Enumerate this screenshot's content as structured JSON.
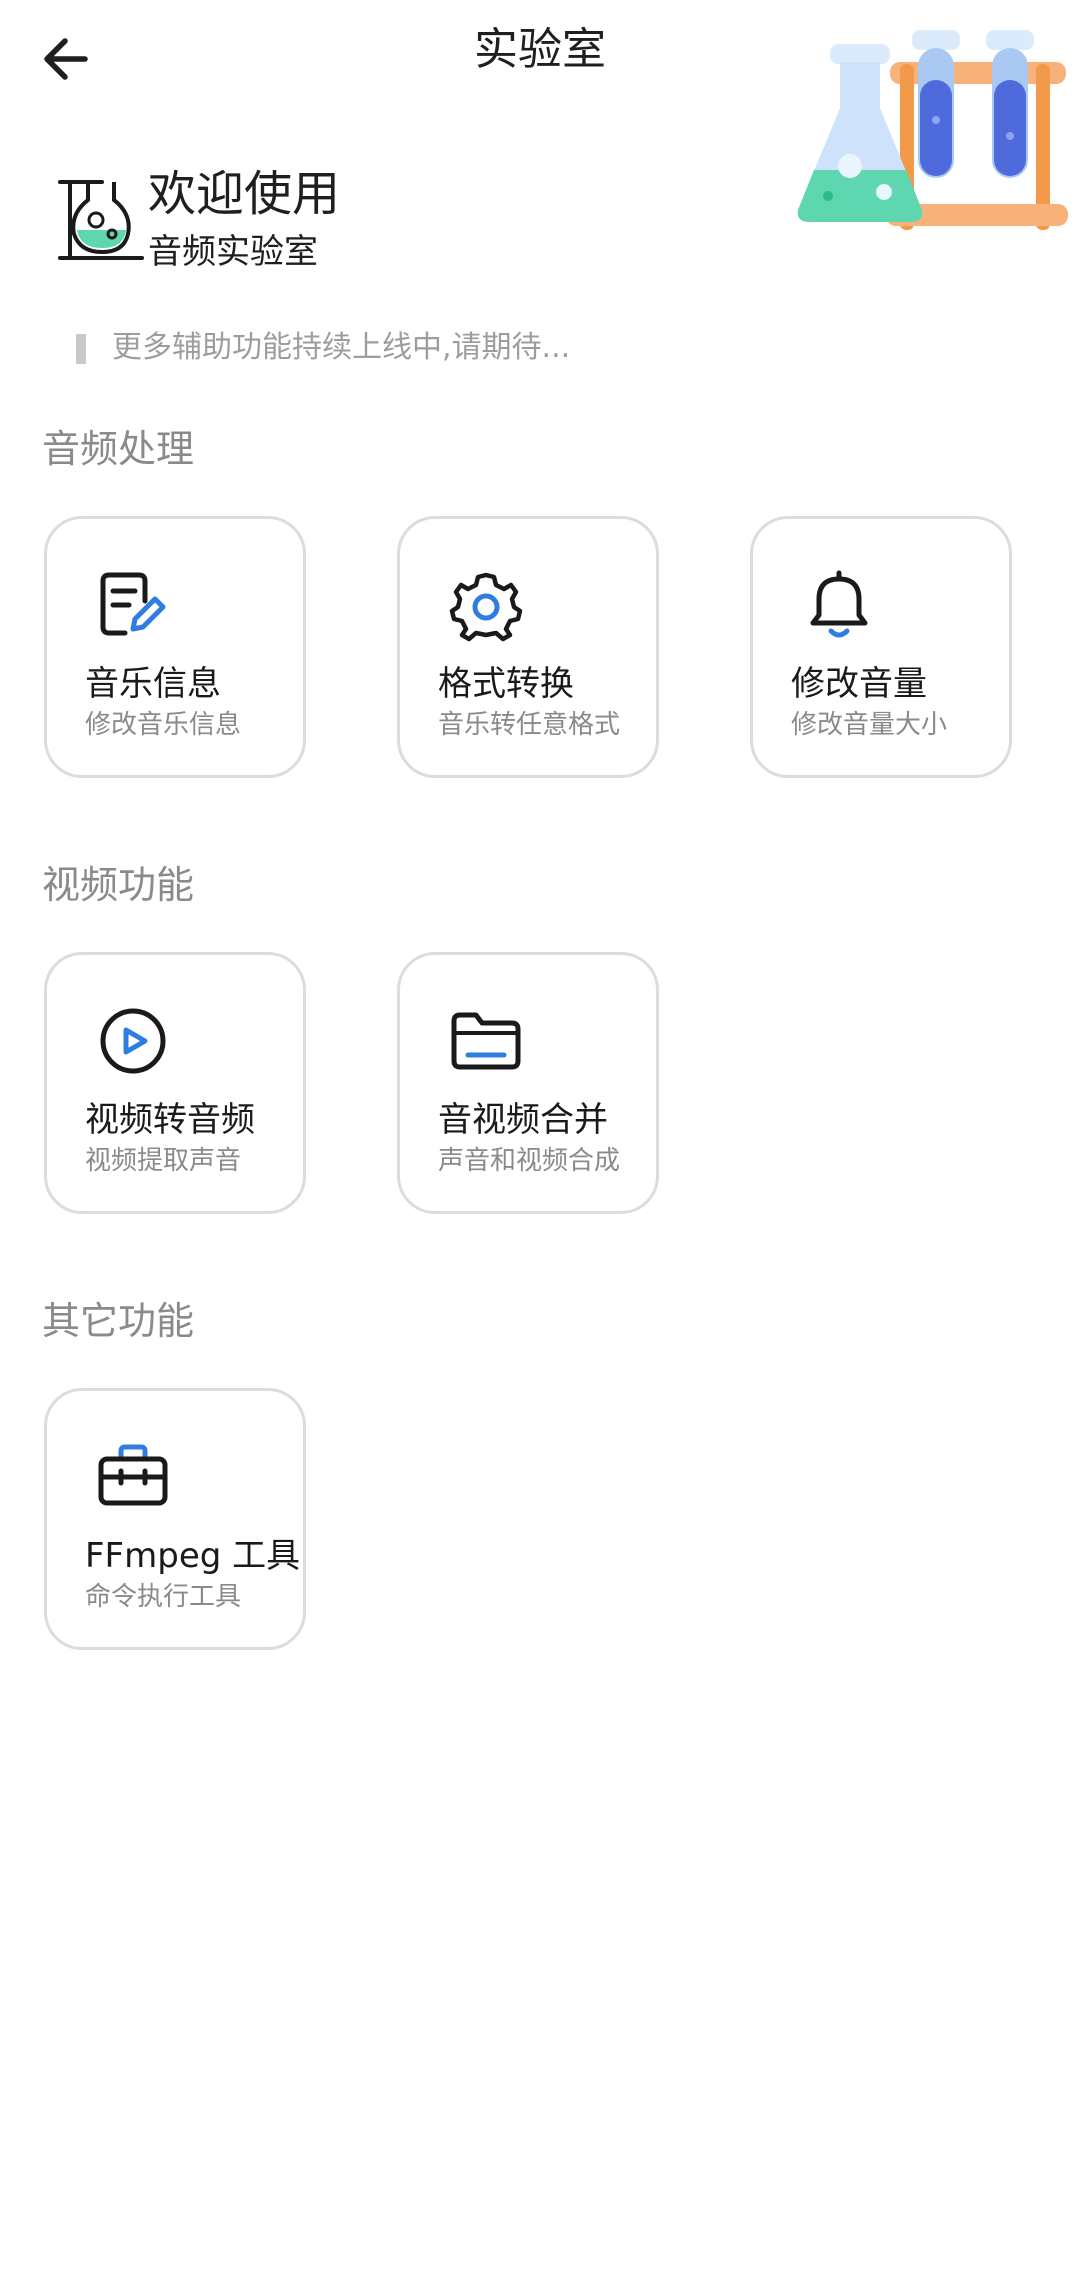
{
  "header": {
    "title": "实验室",
    "back_icon": "arrow-left-icon"
  },
  "welcome": {
    "title": "欢迎使用",
    "subtitle": "音频实验室"
  },
  "notice": "更多辅助功能持续上线中,请期待...",
  "sections": [
    {
      "title": "音频处理",
      "cards": [
        {
          "title": "音乐信息",
          "subtitle": "修改音乐信息",
          "icon": "edit-document-icon"
        },
        {
          "title": "格式转换",
          "subtitle": "音乐转任意格式",
          "icon": "gear-icon"
        },
        {
          "title": "修改音量",
          "subtitle": "修改音量大小",
          "icon": "bell-icon"
        }
      ]
    },
    {
      "title": "视频功能",
      "cards": [
        {
          "title": "视频转音频",
          "subtitle": "视频提取声音",
          "icon": "play-circle-icon"
        },
        {
          "title": "音视频合并",
          "subtitle": "声音和视频合成",
          "icon": "folder-icon"
        }
      ]
    },
    {
      "title": "其它功能",
      "cards": [
        {
          "title": "FFmpeg 工具",
          "subtitle": "命令执行工具",
          "icon": "toolbox-icon"
        }
      ]
    }
  ],
  "colors": {
    "accent": "#2f7de1",
    "section_title": "#8a8a8a",
    "card_border": "#dcdcdc",
    "text_primary": "#1a1a1a"
  }
}
